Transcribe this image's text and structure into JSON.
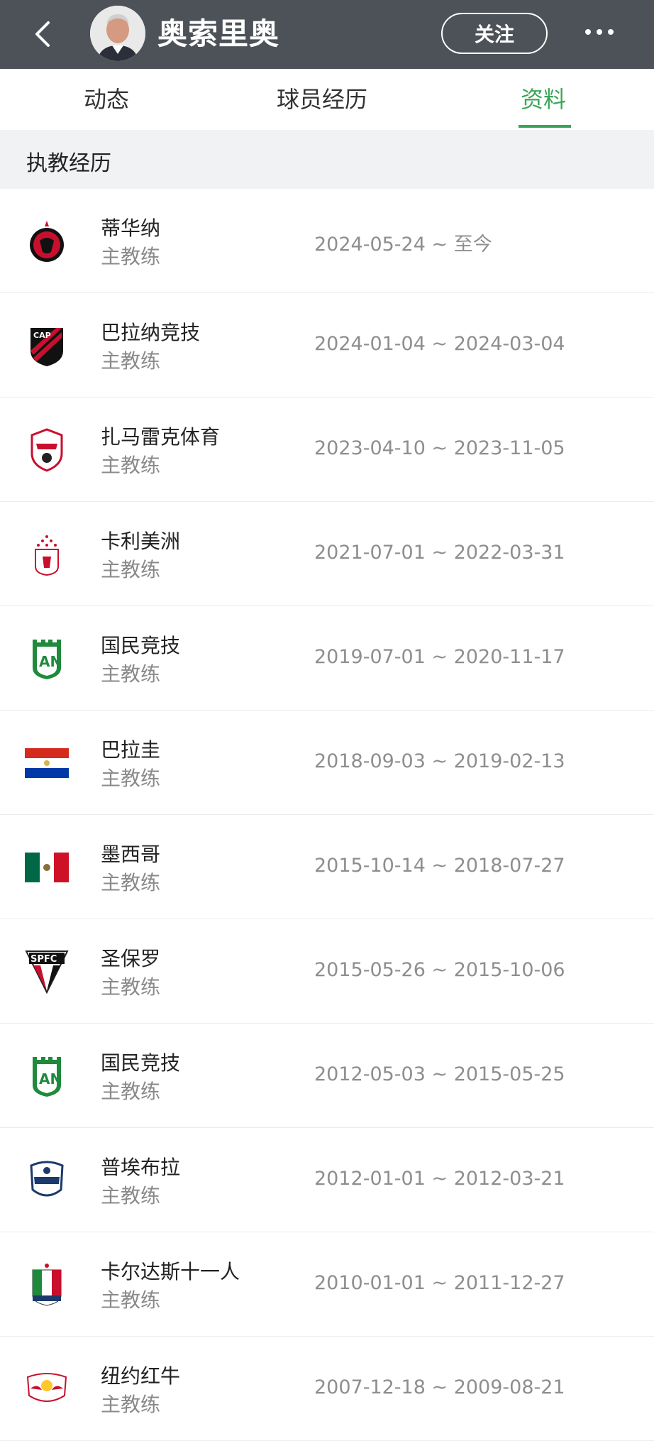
{
  "header": {
    "title": "奥索里奥",
    "follow_label": "关注"
  },
  "tabs": [
    {
      "label": "动态"
    },
    {
      "label": "球员经历"
    },
    {
      "label": "资料"
    }
  ],
  "section": {
    "title": "执教经历"
  },
  "coaching": [
    {
      "team": "蒂华纳",
      "role": "主教练",
      "dates": "2024-05-24 ~ 至今",
      "icon": "tijuana-logo-icon"
    },
    {
      "team": "巴拉纳竞技",
      "role": "主教练",
      "dates": "2024-01-04 ~ 2024-03-04",
      "icon": "athletico-paranaense-logo-icon"
    },
    {
      "team": "扎马雷克体育",
      "role": "主教练",
      "dates": "2023-04-10 ~ 2023-11-05",
      "icon": "zamalek-logo-icon"
    },
    {
      "team": "卡利美洲",
      "role": "主教练",
      "dates": "2021-07-01 ~ 2022-03-31",
      "icon": "america-de-cali-logo-icon"
    },
    {
      "team": "国民竞技",
      "role": "主教练",
      "dates": "2019-07-01 ~ 2020-11-17",
      "icon": "atletico-nacional-logo-icon"
    },
    {
      "team": "巴拉圭",
      "role": "主教练",
      "dates": "2018-09-03 ~ 2019-02-13",
      "icon": "paraguay-flag-icon"
    },
    {
      "team": "墨西哥",
      "role": "主教练",
      "dates": "2015-10-14 ~ 2018-07-27",
      "icon": "mexico-flag-icon"
    },
    {
      "team": "圣保罗",
      "role": "主教练",
      "dates": "2015-05-26 ~ 2015-10-06",
      "icon": "sao-paulo-logo-icon"
    },
    {
      "team": "国民竞技",
      "role": "主教练",
      "dates": "2012-05-03 ~ 2015-05-25",
      "icon": "atletico-nacional-logo-icon"
    },
    {
      "team": "普埃布拉",
      "role": "主教练",
      "dates": "2012-01-01 ~ 2012-03-21",
      "icon": "puebla-logo-icon"
    },
    {
      "team": "卡尔达斯十一人",
      "role": "主教练",
      "dates": "2010-01-01 ~ 2011-12-27",
      "icon": "once-caldas-logo-icon"
    },
    {
      "team": "纽约红牛",
      "role": "主教练",
      "dates": "2007-12-18 ~ 2009-08-21",
      "icon": "red-bulls-logo-icon"
    }
  ],
  "colors": {
    "header_bg": "#4c5258",
    "accent": "#3aa557",
    "section_bg": "#f1f2f4"
  }
}
